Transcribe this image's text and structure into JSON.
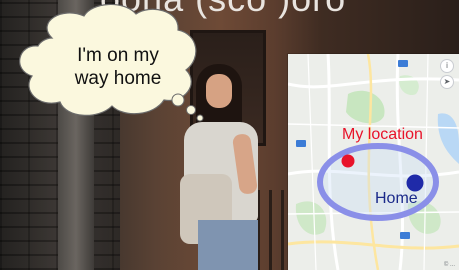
{
  "scene": {
    "header_text": "oona (sco )oro",
    "thought_bubble_text": "I'm on my way home"
  },
  "map": {
    "my_location_label": "My location",
    "home_label": "Home",
    "credit_text": "© ..."
  },
  "colors": {
    "my_location_dot": "#e8132a",
    "home_dot": "#1f2aa8",
    "ellipse_ring": "#7f86e0"
  }
}
